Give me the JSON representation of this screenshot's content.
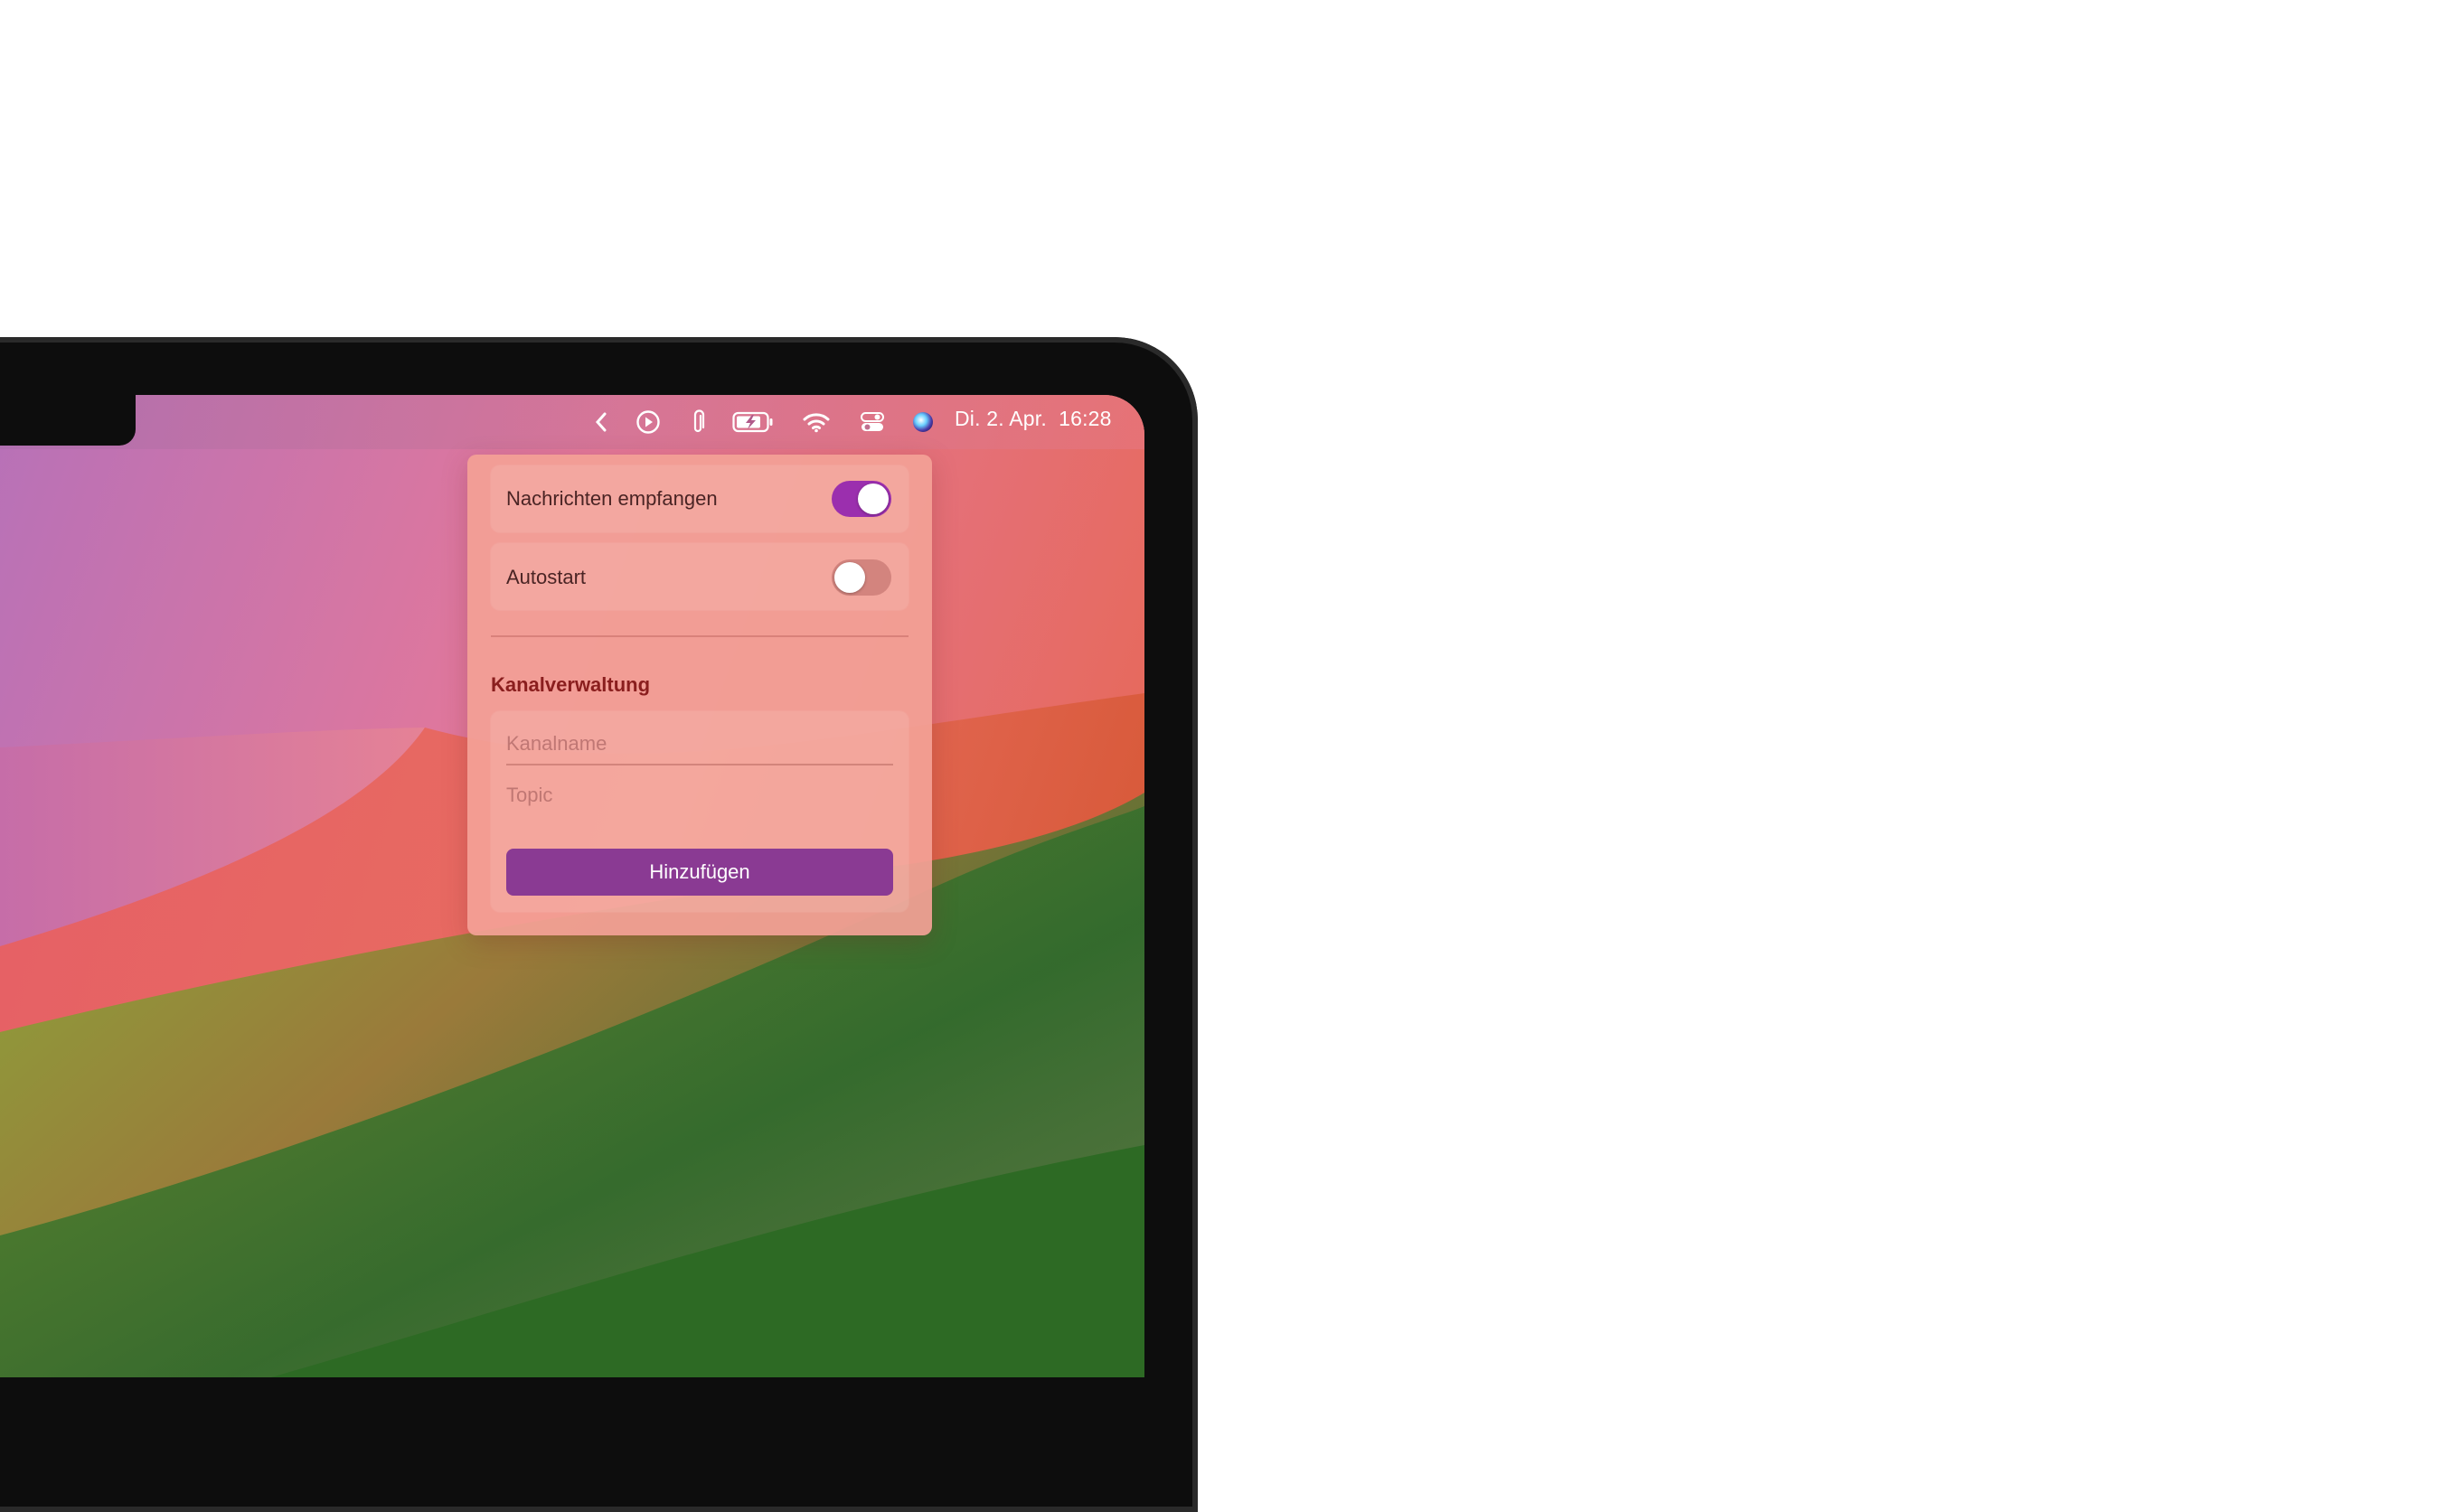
{
  "menubar": {
    "icons": [
      "chevron-left-icon",
      "play-circle-icon",
      "paperclip-icon",
      "battery-charging-icon",
      "wifi-icon",
      "control-center-icon",
      "siri-icon"
    ],
    "date": "Di. 2. Apr.",
    "time": "16:28"
  },
  "popover": {
    "settings": [
      {
        "label": "Nachrichten empfangen",
        "enabled": true
      },
      {
        "label": "Autostart",
        "enabled": false
      }
    ],
    "channel_section": {
      "title": "Kanalverwaltung",
      "channel_name_placeholder": "Kanalname",
      "channel_name_value": "",
      "topic_placeholder": "Topic",
      "topic_value": "",
      "add_label": "Hinzufügen"
    }
  },
  "colors": {
    "accent": "#9b2fae",
    "button": "#8a3a93",
    "section_title": "#8a1e1e"
  }
}
